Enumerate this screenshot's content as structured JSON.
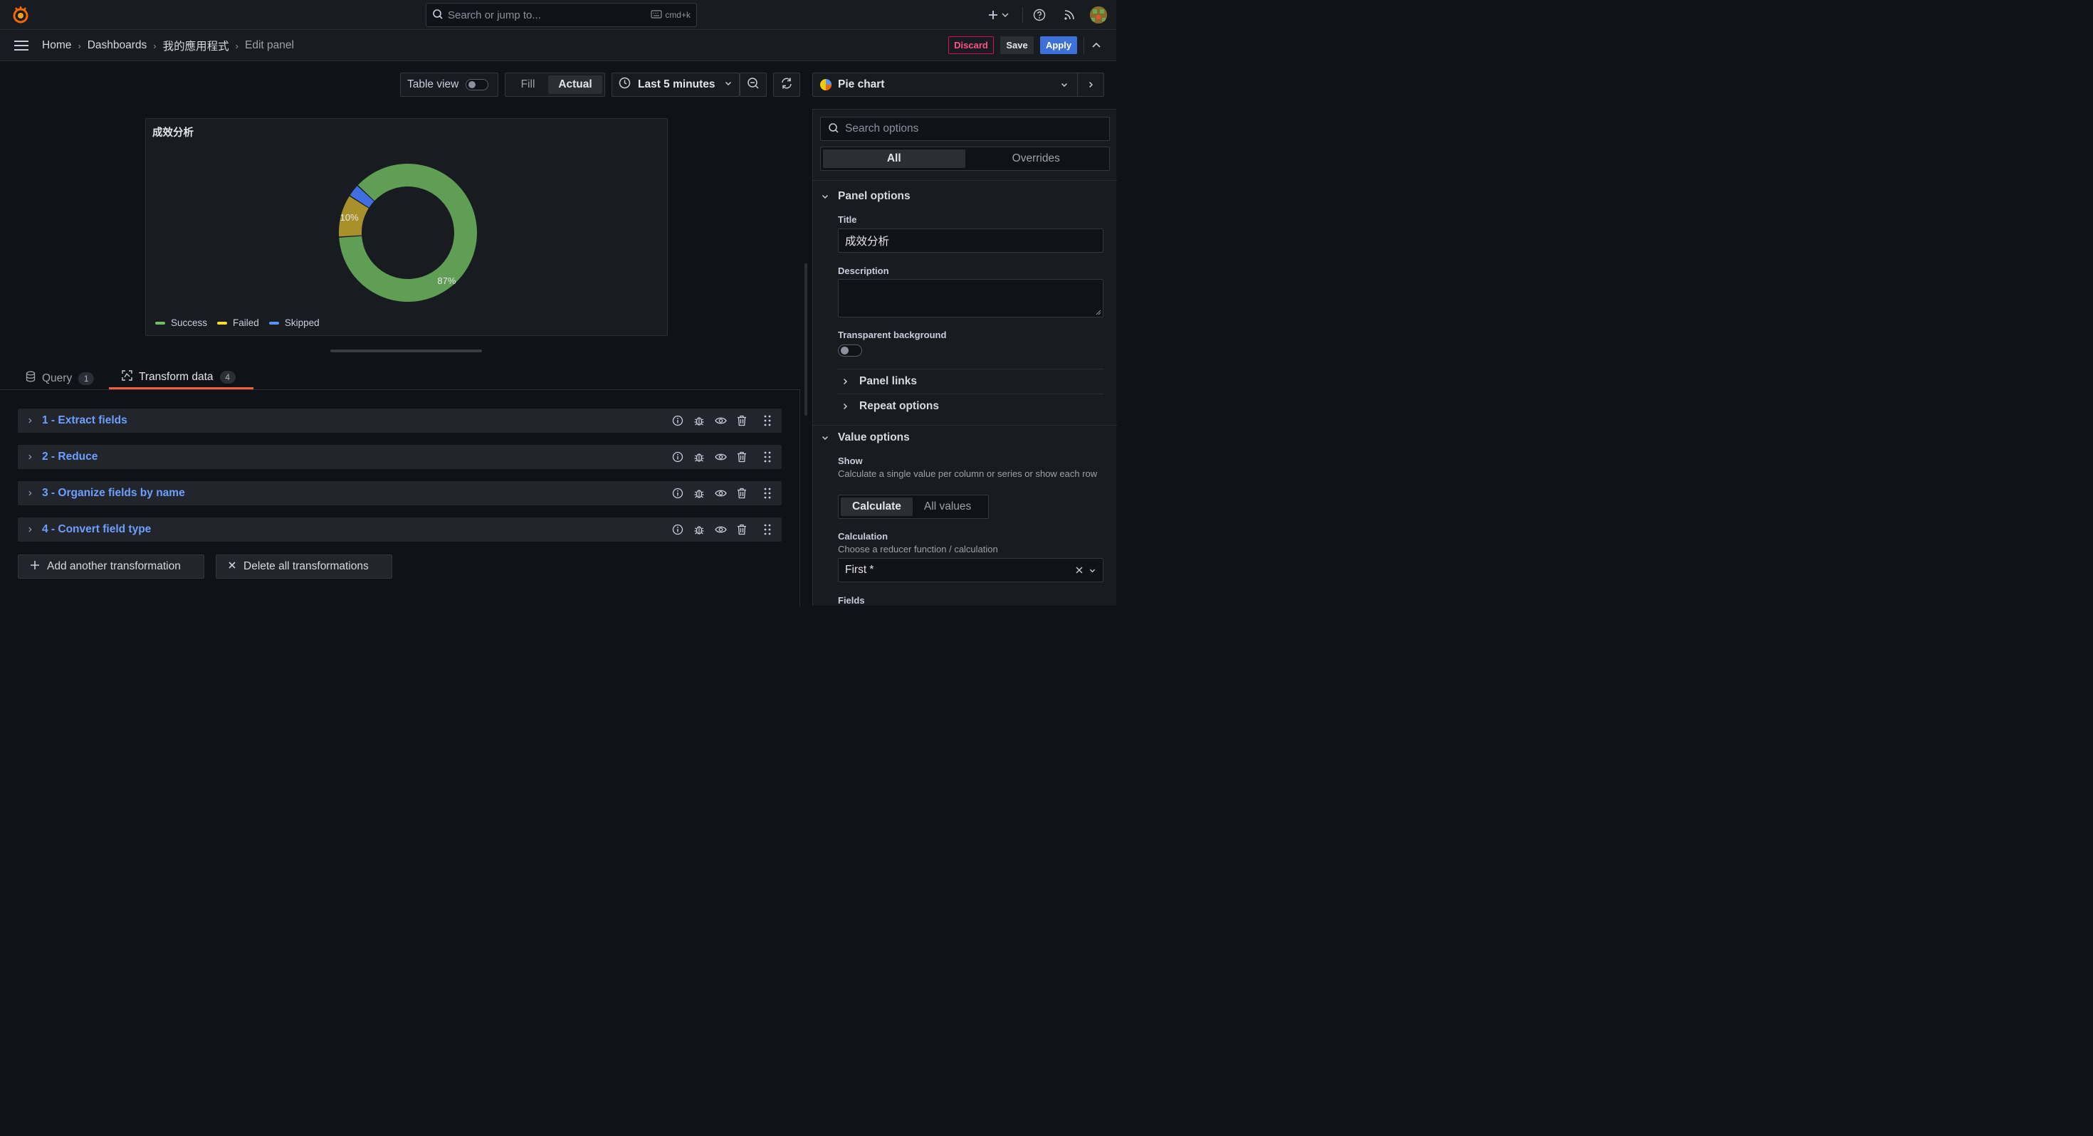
{
  "search": {
    "placeholder": "Search or jump to...",
    "shortcut": "cmd+k"
  },
  "breadcrumb": [
    "Home",
    "Dashboards",
    "我的應用程式",
    "Edit panel"
  ],
  "actions": {
    "discard": "Discard",
    "save": "Save",
    "apply": "Apply"
  },
  "toolbar": {
    "table_view": "Table view",
    "fill": "Fill",
    "actual": "Actual",
    "time_range": "Last 5 minutes"
  },
  "panel": {
    "title": "成效分析",
    "legend": [
      {
        "label": "Success",
        "color": "#73bf69"
      },
      {
        "label": "Failed",
        "color": "#fade2a"
      },
      {
        "label": "Skipped",
        "color": "#5794f2"
      }
    ],
    "slice_labels": {
      "success": "87%",
      "failed": "10%"
    }
  },
  "chart_data": {
    "type": "pie",
    "series": [
      {
        "name": "Success",
        "value": 87,
        "color": "#5f9e54"
      },
      {
        "name": "Failed",
        "value": 10,
        "color": "#a8902a"
      },
      {
        "name": "Skipped",
        "value": 3,
        "color": "#3f6fe0"
      }
    ],
    "title": "成效分析",
    "legend_position": "bottom-left",
    "donut": true
  },
  "tabs": [
    {
      "label": "Query",
      "count": "1"
    },
    {
      "label": "Transform data",
      "count": "4"
    }
  ],
  "transformations": [
    "1 - Extract fields",
    "2 - Reduce",
    "3 - Organize fields by name",
    "4 - Convert field type"
  ],
  "transform_buttons": {
    "add": "Add another transformation",
    "delete": "Delete all transformations"
  },
  "sidebar": {
    "viz_name": "Pie chart",
    "search_placeholder": "Search options",
    "seg_all": "All",
    "seg_overrides": "Overrides",
    "panel_options": "Panel options",
    "title_label": "Title",
    "title_value": "成效分析",
    "description_label": "Description",
    "transparent_label": "Transparent background",
    "panel_links": "Panel links",
    "repeat_options": "Repeat options",
    "value_options": "Value options",
    "show_label": "Show",
    "show_desc": "Calculate a single value per column or series or show each row",
    "calc_seg": "Calculate",
    "all_values_seg": "All values",
    "calculation_label": "Calculation",
    "calculation_desc": "Choose a reducer function / calculation",
    "calculation_value": "First *",
    "fields_label": "Fields"
  }
}
